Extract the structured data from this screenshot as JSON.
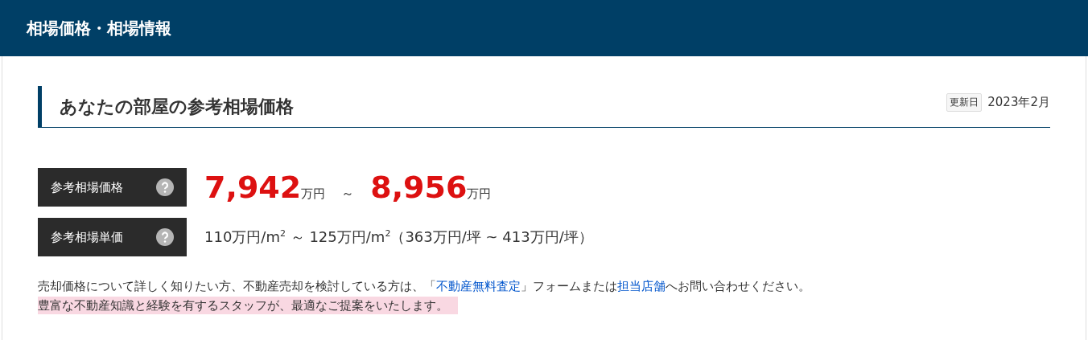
{
  "header": {
    "title": "相場価格・相場情報"
  },
  "section": {
    "title": "あなたの部屋の参考相場価格",
    "updated_label": "更新日",
    "updated_value": "2023年2月"
  },
  "price_rows": [
    {
      "kind": "range",
      "label": "参考相場価格",
      "low": "7,942",
      "low_unit": "万円",
      "sep": "～",
      "high": "8,956",
      "high_unit": "万円"
    },
    {
      "kind": "text",
      "label": "参考相場単価",
      "text": "110万円/m$^{2}$ ～ 125万円/m$^{2}$（363万円/坪 ~ 413万円/坪）"
    }
  ],
  "note": {
    "parts": [
      {
        "kind": "text",
        "text": "売却価格について詳しく知りたい方、不動産売却を検討している方は、「"
      },
      {
        "kind": "link",
        "text": "不動産無料査定"
      },
      {
        "kind": "text",
        "text": "」フォームまたは"
      },
      {
        "kind": "link",
        "text": "担当店舗"
      },
      {
        "kind": "text",
        "text": "へお問い合わせください。"
      }
    ],
    "highlight": "豊富な不動産知識と経験を有するスタッフが、最適なご提案をいたします。"
  }
}
